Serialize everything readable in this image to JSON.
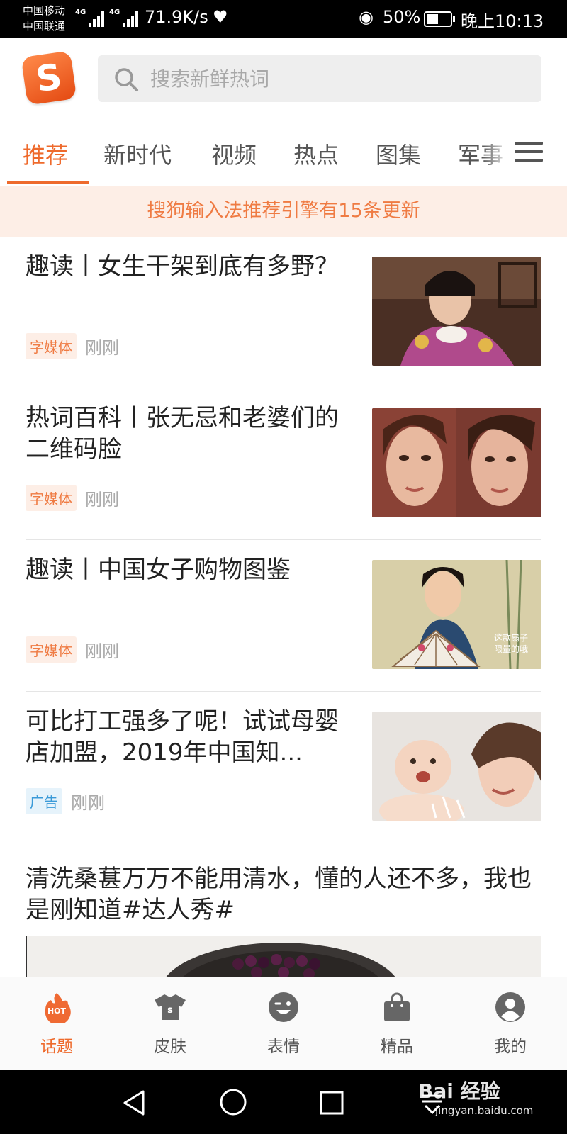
{
  "status_bar": {
    "carrier_1": "中国移动",
    "carrier_2": "中国联通",
    "net_1": "4G",
    "net_2": "4G",
    "net_speed": "71.9K/s",
    "battery_percent": "50%",
    "battery_level": 0.5,
    "time": "晚上10:13"
  },
  "header": {
    "logo_letter": "S",
    "search_placeholder": "搜索新鲜热词"
  },
  "tabs": [
    {
      "label": "推荐",
      "active": true
    },
    {
      "label": "新时代"
    },
    {
      "label": "视频"
    },
    {
      "label": "热点"
    },
    {
      "label": "图集"
    },
    {
      "label": "军事"
    }
  ],
  "banner": "搜狗输入法推荐引擎有15条更新",
  "feed": [
    {
      "title": "趣读丨女生干架到底有多野？",
      "badge": "字媒体",
      "time": "刚刚"
    },
    {
      "title": "热词百科丨张无忌和老婆们的二维码脸",
      "badge": "字媒体",
      "time": "刚刚"
    },
    {
      "title": "趣读丨中国女子购物图鉴",
      "badge": "字媒体",
      "time": "刚刚",
      "image_caption_1": "这款扇子",
      "image_caption_2": "限量的哦"
    },
    {
      "title": "可比打工强多了呢！试试母婴店加盟，2019年中国知...",
      "badge": "广告",
      "time": "刚刚"
    }
  ],
  "big_item": {
    "title": "清洗桑葚万万不能用清水，懂的人还不多，我也是刚知道#达人秀#"
  },
  "bottom_nav": [
    {
      "label": "话题",
      "icon": "hot-icon",
      "active": true,
      "icon_text": "HOT"
    },
    {
      "label": "皮肤",
      "icon": "shirt-icon"
    },
    {
      "label": "表情",
      "icon": "emoji-icon"
    },
    {
      "label": "精品",
      "icon": "bag-icon"
    },
    {
      "label": "我的",
      "icon": "user-icon"
    }
  ],
  "watermark": {
    "main": "Bai 经验",
    "sub": "jingyan.baidu.com"
  },
  "colors": {
    "accent": "#ee6a2c",
    "banner_bg": "#fdeee6",
    "ad_blue": "#3a9ad8"
  }
}
